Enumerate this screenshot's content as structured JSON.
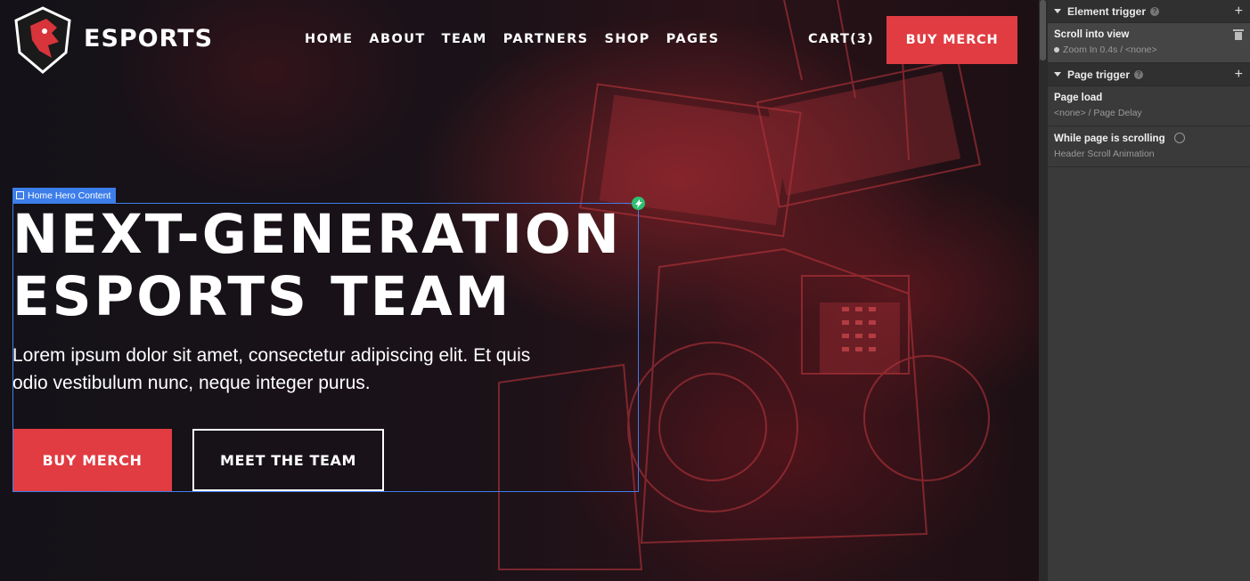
{
  "nav": {
    "brand": "ESPORTS",
    "menu": [
      "HOME",
      "ABOUT",
      "TEAM",
      "PARTNERS",
      "SHOP",
      "PAGES"
    ],
    "cart": "CART(3)",
    "cta": "BUY MERCH"
  },
  "selection": {
    "label": "Home Hero Content"
  },
  "hero": {
    "title_line1": "NEXT-GENERATION",
    "title_line2": "ESPORTS TEAM",
    "text": "Lorem ipsum dolor sit amet, consectetur adipiscing elit. Et quis odio vestibulum nunc, neque integer purus.",
    "primary_button": "BUY MERCH",
    "secondary_button": "MEET THE TEAM"
  },
  "panel": {
    "element_trigger": {
      "title": "Element trigger",
      "item": {
        "title": "Scroll into view",
        "subtitle": "Zoom In 0.4s / <none>"
      }
    },
    "page_trigger": {
      "title": "Page trigger",
      "items": [
        {
          "title": "Page load",
          "subtitle": "<none> / Page Delay"
        },
        {
          "title": "While page is scrolling",
          "subtitle": "Header Scroll Animation"
        }
      ]
    }
  },
  "colors": {
    "accent": "#e03c42",
    "selection": "#3d7eea",
    "panel_bg": "#3a3a3a"
  }
}
